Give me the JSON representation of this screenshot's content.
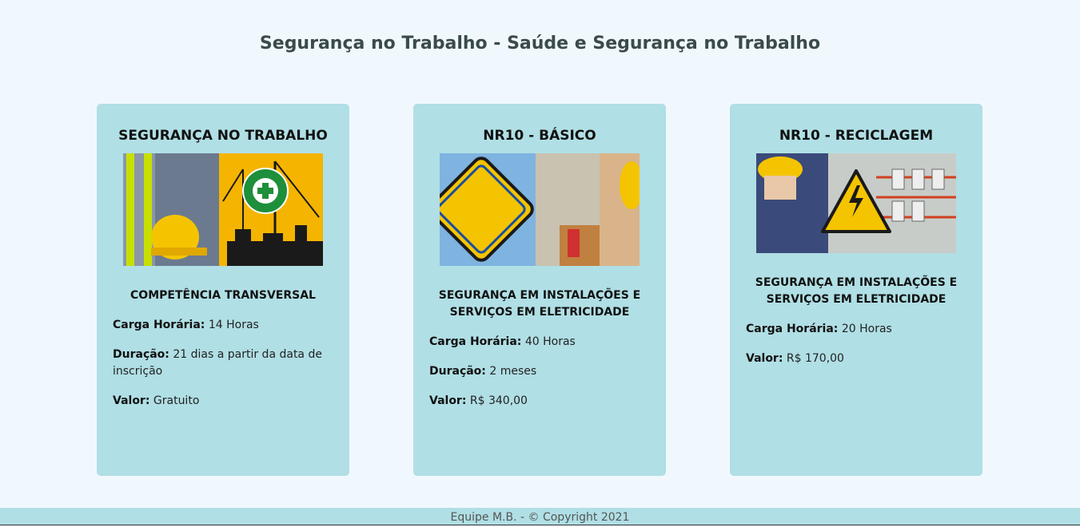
{
  "header": {
    "title": "Segurança no Trabalho - Saúde e Segurança no Trabalho"
  },
  "cards": [
    {
      "title": "SEGURANÇA NO TRABALHO",
      "image_label": "SEGURANÇA DO TRABALHO",
      "subtitle": "COMPETÊNCIA TRANSVERSAL",
      "carga_label": "Carga Horária:",
      "carga_value": "14 Horas",
      "duracao_label": "Duração:",
      "duracao_value": "21 dias a partir da data de inscrição",
      "valor_label": "Valor:",
      "valor_value": "Gratuito"
    },
    {
      "title": "NR10 - BÁSICO",
      "image_label": "NR 10",
      "subtitle": "SEGURANÇA EM INSTALAÇÕES E SERVIÇOS EM ELETRICIDADE",
      "carga_label": "Carga Horária:",
      "carga_value": "40 Horas",
      "duracao_label": "Duração:",
      "duracao_value": "2 meses",
      "valor_label": "Valor:",
      "valor_value": "R$ 340,00"
    },
    {
      "title": "NR10 - RECICLAGEM",
      "image_label": "NR-10",
      "subtitle": "SEGURANÇA EM INSTALAÇÕES E SERVIÇOS EM ELETRICIDADE",
      "carga_label": "Carga Horária:",
      "carga_value": "20 Horas",
      "valor_label": "Valor:",
      "valor_value": "R$ 170,00"
    }
  ],
  "footer": {
    "text": "Equipe M.B. - © Copyright 2021"
  },
  "colors": {
    "background": "#f0f8fe",
    "card": "#b0dfe5",
    "title": "#3b4a4a"
  }
}
